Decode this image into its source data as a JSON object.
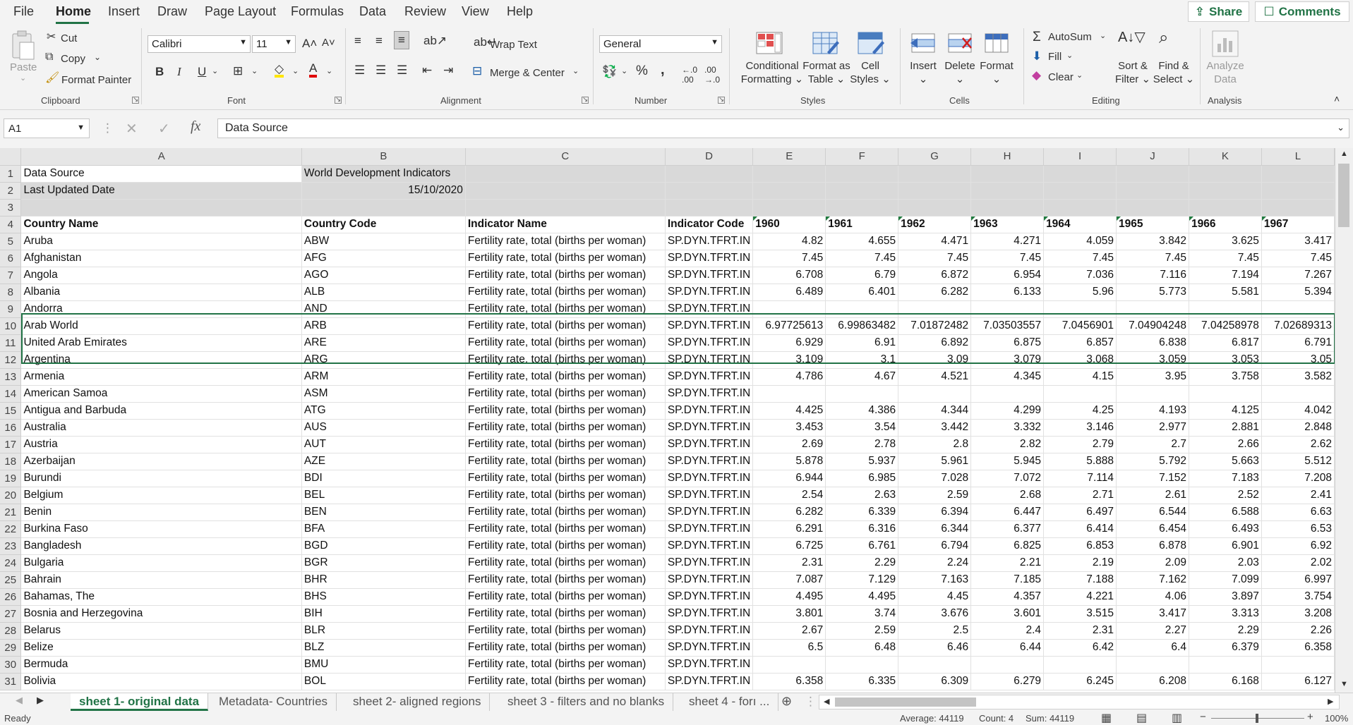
{
  "menu": {
    "items": [
      "File",
      "Home",
      "Insert",
      "Draw",
      "Page Layout",
      "Formulas",
      "Data",
      "Review",
      "View",
      "Help"
    ],
    "share": "Share",
    "comments": "Comments"
  },
  "ribbon": {
    "clipboard": {
      "paste": "Paste",
      "cut": "Cut",
      "copy": "Copy",
      "format_painter": "Format Painter",
      "label": "Clipboard"
    },
    "font": {
      "name": "Calibri",
      "size": "11",
      "label": "Font",
      "bold": "B",
      "italic": "I",
      "underline": "U"
    },
    "alignment": {
      "wrap_text": "Wrap Text",
      "merge_center": "Merge & Center",
      "label": "Alignment"
    },
    "number": {
      "format": "General",
      "label": "Number"
    },
    "styles": {
      "conditional": [
        "Conditional",
        "Formatting"
      ],
      "format_table": [
        "Format as",
        "Table"
      ],
      "cell_styles": [
        "Cell",
        "Styles"
      ],
      "label": "Styles"
    },
    "cells": {
      "insert": "Insert",
      "delete": "Delete",
      "format": "Format",
      "label": "Cells"
    },
    "editing": {
      "autosum": "AutoSum",
      "fill": "Fill",
      "clear": "Clear",
      "sort_filter": [
        "Sort &",
        "Filter"
      ],
      "find_select": [
        "Find &",
        "Select"
      ],
      "label": "Editing"
    },
    "analysis": {
      "analyze": [
        "Analyze",
        "Data"
      ],
      "label": "Analysis"
    }
  },
  "formula_bar": {
    "name_box": "A1",
    "content": "Data Source"
  },
  "columns": [
    "A",
    "B",
    "C",
    "D",
    "E",
    "F",
    "G",
    "H",
    "I",
    "J",
    "K",
    "L"
  ],
  "rows": [
    {
      "n": "1",
      "cells": [
        "Data Source",
        "World Development Indicators",
        "",
        "",
        "",
        "",
        "",
        "",
        "",
        "",
        "",
        ""
      ]
    },
    {
      "n": "2",
      "cells": [
        "Last Updated Date",
        "15/10/2020",
        "",
        "",
        "",
        "",
        "",
        "",
        "",
        "",
        "",
        ""
      ]
    },
    {
      "n": "3",
      "cells": [
        "",
        "",
        "",
        "",
        "",
        "",
        "",
        "",
        "",
        "",
        "",
        ""
      ]
    },
    {
      "n": "4",
      "cells": [
        "Country Name",
        "Country Code",
        "Indicator Name",
        "Indicator Code",
        "1960",
        "1961",
        "1962",
        "1963",
        "1964",
        "1965",
        "1966",
        "1967"
      ]
    },
    {
      "n": "5",
      "cells": [
        "Aruba",
        "ABW",
        "Fertility rate, total (births per woman)",
        "SP.DYN.TFRT.IN",
        "4.82",
        "4.655",
        "4.471",
        "4.271",
        "4.059",
        "3.842",
        "3.625",
        "3.417"
      ]
    },
    {
      "n": "6",
      "cells": [
        "Afghanistan",
        "AFG",
        "Fertility rate, total (births per woman)",
        "SP.DYN.TFRT.IN",
        "7.45",
        "7.45",
        "7.45",
        "7.45",
        "7.45",
        "7.45",
        "7.45",
        "7.45"
      ]
    },
    {
      "n": "7",
      "cells": [
        "Angola",
        "AGO",
        "Fertility rate, total (births per woman)",
        "SP.DYN.TFRT.IN",
        "6.708",
        "6.79",
        "6.872",
        "6.954",
        "7.036",
        "7.116",
        "7.194",
        "7.267"
      ]
    },
    {
      "n": "8",
      "cells": [
        "Albania",
        "ALB",
        "Fertility rate, total (births per woman)",
        "SP.DYN.TFRT.IN",
        "6.489",
        "6.401",
        "6.282",
        "6.133",
        "5.96",
        "5.773",
        "5.581",
        "5.394"
      ]
    },
    {
      "n": "9",
      "cells": [
        "Andorra",
        "AND",
        "Fertility rate, total (births per woman)",
        "SP.DYN.TFRT.IN",
        "",
        "",
        "",
        "",
        "",
        "",
        "",
        ""
      ]
    },
    {
      "n": "10",
      "cells": [
        "Arab World",
        "ARB",
        "Fertility rate, total (births per woman)",
        "SP.DYN.TFRT.IN",
        "6.97725613",
        "6.99863482",
        "7.01872482",
        "7.03503557",
        "7.0456901",
        "7.04904248",
        "7.04258978",
        "7.02689313"
      ]
    },
    {
      "n": "11",
      "cells": [
        "United Arab Emirates",
        "ARE",
        "Fertility rate, total (births per woman)",
        "SP.DYN.TFRT.IN",
        "6.929",
        "6.91",
        "6.892",
        "6.875",
        "6.857",
        "6.838",
        "6.817",
        "6.791"
      ]
    },
    {
      "n": "12",
      "cells": [
        "Argentina",
        "ARG",
        "Fertility rate, total (births per woman)",
        "SP.DYN.TFRT.IN",
        "3.109",
        "3.1",
        "3.09",
        "3.079",
        "3.068",
        "3.059",
        "3.053",
        "3.05"
      ]
    },
    {
      "n": "13",
      "cells": [
        "Armenia",
        "ARM",
        "Fertility rate, total (births per woman)",
        "SP.DYN.TFRT.IN",
        "4.786",
        "4.67",
        "4.521",
        "4.345",
        "4.15",
        "3.95",
        "3.758",
        "3.582"
      ]
    },
    {
      "n": "14",
      "cells": [
        "American Samoa",
        "ASM",
        "Fertility rate, total (births per woman)",
        "SP.DYN.TFRT.IN",
        "",
        "",
        "",
        "",
        "",
        "",
        "",
        ""
      ]
    },
    {
      "n": "15",
      "cells": [
        "Antigua and Barbuda",
        "ATG",
        "Fertility rate, total (births per woman)",
        "SP.DYN.TFRT.IN",
        "4.425",
        "4.386",
        "4.344",
        "4.299",
        "4.25",
        "4.193",
        "4.125",
        "4.042"
      ]
    },
    {
      "n": "16",
      "cells": [
        "Australia",
        "AUS",
        "Fertility rate, total (births per woman)",
        "SP.DYN.TFRT.IN",
        "3.453",
        "3.54",
        "3.442",
        "3.332",
        "3.146",
        "2.977",
        "2.881",
        "2.848"
      ]
    },
    {
      "n": "17",
      "cells": [
        "Austria",
        "AUT",
        "Fertility rate, total (births per woman)",
        "SP.DYN.TFRT.IN",
        "2.69",
        "2.78",
        "2.8",
        "2.82",
        "2.79",
        "2.7",
        "2.66",
        "2.62"
      ]
    },
    {
      "n": "18",
      "cells": [
        "Azerbaijan",
        "AZE",
        "Fertility rate, total (births per woman)",
        "SP.DYN.TFRT.IN",
        "5.878",
        "5.937",
        "5.961",
        "5.945",
        "5.888",
        "5.792",
        "5.663",
        "5.512"
      ]
    },
    {
      "n": "19",
      "cells": [
        "Burundi",
        "BDI",
        "Fertility rate, total (births per woman)",
        "SP.DYN.TFRT.IN",
        "6.944",
        "6.985",
        "7.028",
        "7.072",
        "7.114",
        "7.152",
        "7.183",
        "7.208"
      ]
    },
    {
      "n": "20",
      "cells": [
        "Belgium",
        "BEL",
        "Fertility rate, total (births per woman)",
        "SP.DYN.TFRT.IN",
        "2.54",
        "2.63",
        "2.59",
        "2.68",
        "2.71",
        "2.61",
        "2.52",
        "2.41"
      ]
    },
    {
      "n": "21",
      "cells": [
        "Benin",
        "BEN",
        "Fertility rate, total (births per woman)",
        "SP.DYN.TFRT.IN",
        "6.282",
        "6.339",
        "6.394",
        "6.447",
        "6.497",
        "6.544",
        "6.588",
        "6.63"
      ]
    },
    {
      "n": "22",
      "cells": [
        "Burkina Faso",
        "BFA",
        "Fertility rate, total (births per woman)",
        "SP.DYN.TFRT.IN",
        "6.291",
        "6.316",
        "6.344",
        "6.377",
        "6.414",
        "6.454",
        "6.493",
        "6.53"
      ]
    },
    {
      "n": "23",
      "cells": [
        "Bangladesh",
        "BGD",
        "Fertility rate, total (births per woman)",
        "SP.DYN.TFRT.IN",
        "6.725",
        "6.761",
        "6.794",
        "6.825",
        "6.853",
        "6.878",
        "6.901",
        "6.92"
      ]
    },
    {
      "n": "24",
      "cells": [
        "Bulgaria",
        "BGR",
        "Fertility rate, total (births per woman)",
        "SP.DYN.TFRT.IN",
        "2.31",
        "2.29",
        "2.24",
        "2.21",
        "2.19",
        "2.09",
        "2.03",
        "2.02"
      ]
    },
    {
      "n": "25",
      "cells": [
        "Bahrain",
        "BHR",
        "Fertility rate, total (births per woman)",
        "SP.DYN.TFRT.IN",
        "7.087",
        "7.129",
        "7.163",
        "7.185",
        "7.188",
        "7.162",
        "7.099",
        "6.997"
      ]
    },
    {
      "n": "26",
      "cells": [
        "Bahamas, The",
        "BHS",
        "Fertility rate, total (births per woman)",
        "SP.DYN.TFRT.IN",
        "4.495",
        "4.495",
        "4.45",
        "4.357",
        "4.221",
        "4.06",
        "3.897",
        "3.754"
      ]
    },
    {
      "n": "27",
      "cells": [
        "Bosnia and Herzegovina",
        "BIH",
        "Fertility rate, total (births per woman)",
        "SP.DYN.TFRT.IN",
        "3.801",
        "3.74",
        "3.676",
        "3.601",
        "3.515",
        "3.417",
        "3.313",
        "3.208"
      ]
    },
    {
      "n": "28",
      "cells": [
        "Belarus",
        "BLR",
        "Fertility rate, total (births per woman)",
        "SP.DYN.TFRT.IN",
        "2.67",
        "2.59",
        "2.5",
        "2.4",
        "2.31",
        "2.27",
        "2.29",
        "2.26"
      ]
    },
    {
      "n": "29",
      "cells": [
        "Belize",
        "BLZ",
        "Fertility rate, total (births per woman)",
        "SP.DYN.TFRT.IN",
        "6.5",
        "6.48",
        "6.46",
        "6.44",
        "6.42",
        "6.4",
        "6.379",
        "6.358"
      ]
    },
    {
      "n": "30",
      "cells": [
        "Bermuda",
        "BMU",
        "Fertility rate, total (births per woman)",
        "SP.DYN.TFRT.IN",
        "",
        "",
        "",
        "",
        "",
        "",
        "",
        ""
      ]
    },
    {
      "n": "31",
      "cells": [
        "Bolivia",
        "BOL",
        "Fertility rate, total (births per woman)",
        "SP.DYN.TFRT.IN",
        "6.358",
        "6.335",
        "6.309",
        "6.279",
        "6.245",
        "6.208",
        "6.168",
        "6.127"
      ]
    }
  ],
  "sheet_tabs": [
    "sheet 1- original data",
    "Metadata- Countries",
    "sheet 2- aligned regions",
    "sheet 3 - filters and no blanks",
    "sheet 4 - forı ..."
  ],
  "status": {
    "ready": "Ready",
    "average": "Average: 44119",
    "count": "Count: 4",
    "sum": "Sum: 44119",
    "zoom": "100%"
  },
  "colors": {
    "accent": "#217346"
  }
}
